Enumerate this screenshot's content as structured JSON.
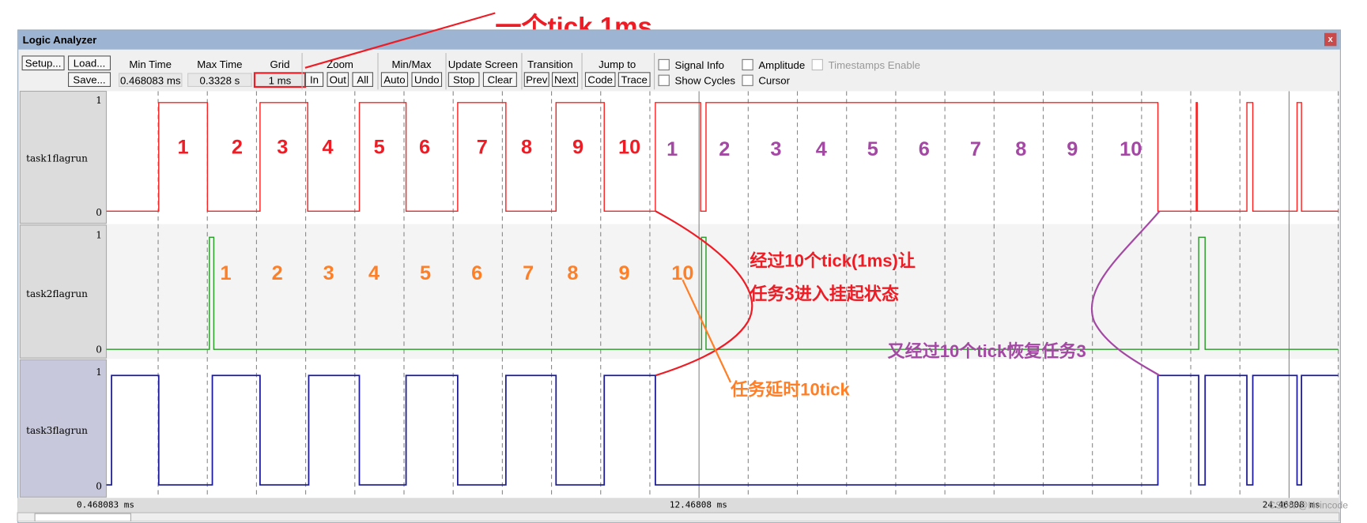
{
  "window": {
    "title": "Logic Analyzer",
    "close_label": "x"
  },
  "toolbar": {
    "setup": "Setup...",
    "load": "Load...",
    "save": "Save...",
    "min_time_label": "Min Time",
    "min_time": "0.468083 ms",
    "max_time_label": "Max Time",
    "max_time": "0.3328 s",
    "grid_label": "Grid",
    "grid": "1 ms",
    "zoom_label": "Zoom",
    "zoom_in": "In",
    "zoom_out": "Out",
    "zoom_all": "All",
    "minmax_label": "Min/Max",
    "auto": "Auto",
    "undo": "Undo",
    "update_label": "Update Screen",
    "stop": "Stop",
    "clear": "Clear",
    "transition_label": "Transition",
    "prev": "Prev",
    "next": "Next",
    "jump_label": "Jump to",
    "code": "Code",
    "trace": "Trace",
    "checkboxes": {
      "signal_info": "Signal Info",
      "amplitude": "Amplitude",
      "timestamps": "Timestamps Enable",
      "show_cycles": "Show Cycles",
      "cursor": "Cursor"
    }
  },
  "signals": [
    {
      "name": "task1flagrun",
      "color": "#ff2020",
      "high": "1",
      "low": "0",
      "initial": 0,
      "transitions_ms": [
        1.48,
        2.47,
        3.54,
        4.51,
        5.56,
        6.51,
        7.56,
        8.54,
        9.56,
        10.54,
        11.58,
        12.5,
        12.61,
        21.8,
        22.58,
        22.6,
        23.61,
        23.73,
        24.63,
        24.72
      ]
    },
    {
      "name": "task2flagrun",
      "color": "#2a9a2a",
      "high": "1",
      "low": "0",
      "initial": 0,
      "transitions_ms": [
        2.51,
        2.6,
        12.52,
        12.61,
        22.63,
        22.76
      ]
    },
    {
      "name": "task3flagrun",
      "color": "#1a1a9a",
      "high": "1",
      "low": "0",
      "initial": 0,
      "transitions_ms": [
        0.52,
        1.48,
        2.57,
        3.54,
        4.53,
        5.56,
        6.51,
        7.56,
        8.54,
        9.56,
        10.54,
        11.58,
        21.8,
        22.63,
        22.76,
        23.61,
        23.73,
        24.63,
        24.72
      ]
    }
  ],
  "axis": {
    "min_ms": 0.468083,
    "grid_ms": 1,
    "labels": [
      "0.468083 ms",
      "12.46808 ms",
      "24.46808 ms"
    ]
  },
  "annotations": {
    "tick_note": "一个tick 1ms",
    "task1_counts_red": [
      "1",
      "2",
      "3",
      "4",
      "5",
      "6",
      "7",
      "8",
      "9",
      "10"
    ],
    "task1_counts_purple": [
      "1",
      "2",
      "3",
      "4",
      "5",
      "6",
      "7",
      "8",
      "9",
      "10"
    ],
    "task2_counts": [
      "1",
      "2",
      "3",
      "4",
      "5",
      "6",
      "7",
      "8",
      "9",
      "10"
    ],
    "suspend_line1": "经过10个tick(1ms)让",
    "suspend_line2": "任务3进入挂起状态",
    "delay_note": "任务延时10tick",
    "resume_note": "又经过10个tick恢复任务3",
    "colors": {
      "red": "#ee1c25",
      "orange": "#ff7f27",
      "purple": "#a349a4"
    }
  },
  "watermark": "CSDN @Hvincode"
}
